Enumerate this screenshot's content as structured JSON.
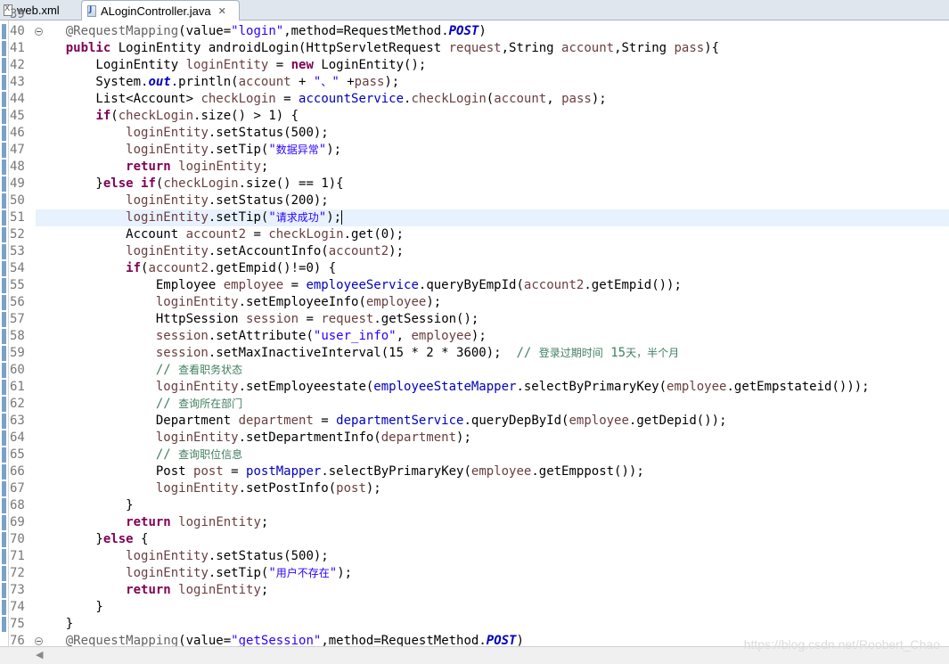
{
  "tabs": [
    {
      "label": "web.xml",
      "icon": "xml-file-icon"
    },
    {
      "label": "ALoginController.java",
      "icon": "java-file-icon",
      "close": "✕"
    }
  ],
  "colors": {
    "keyword": "#7f0055",
    "annotation": "#646464",
    "string": "#2a00ff",
    "comment": "#3f7f5f",
    "field": "#0000c0",
    "local_var": "#6a3e3e",
    "current_line": "#e8f2fe"
  },
  "code_lines": [
    {
      "n": "39",
      "text": ""
    },
    {
      "n": "40",
      "text": "    @RequestMapping(value=\"login\",method=RequestMethod.POST)",
      "fold": true
    },
    {
      "n": "41",
      "text": "    public LoginEntity androidLogin(HttpServletRequest request,String account,String pass){"
    },
    {
      "n": "42",
      "text": "        LoginEntity loginEntity = new LoginEntity();"
    },
    {
      "n": "43",
      "text": "        System.out.println(account + \"、\" +pass);"
    },
    {
      "n": "44",
      "text": "        List<Account> checkLogin = accountService.checkLogin(account, pass);"
    },
    {
      "n": "45",
      "text": "        if(checkLogin.size() > 1) {"
    },
    {
      "n": "46",
      "text": "            loginEntity.setStatus(500);"
    },
    {
      "n": "47",
      "text": "            loginEntity.setTip(\"数据异常\");"
    },
    {
      "n": "48",
      "text": "            return loginEntity;"
    },
    {
      "n": "49",
      "text": "        }else if(checkLogin.size() == 1){"
    },
    {
      "n": "50",
      "text": "            loginEntity.setStatus(200);"
    },
    {
      "n": "51",
      "text": "            loginEntity.setTip(\"请求成功\");",
      "current": true
    },
    {
      "n": "52",
      "text": "            Account account2 = checkLogin.get(0);"
    },
    {
      "n": "53",
      "text": "            loginEntity.setAccountInfo(account2);"
    },
    {
      "n": "54",
      "text": "            if(account2.getEmpid()!=0) {"
    },
    {
      "n": "55",
      "text": "                Employee employee = employeeService.queryByEmpId(account2.getEmpid());"
    },
    {
      "n": "56",
      "text": "                loginEntity.setEmployeeInfo(employee);"
    },
    {
      "n": "57",
      "text": "                HttpSession session = request.getSession();"
    },
    {
      "n": "58",
      "text": "                session.setAttribute(\"user_info\", employee);"
    },
    {
      "n": "59",
      "text": "                session.setMaxInactiveInterval(15 * 2 * 3600);  // 登录过期时间 15天，半个月"
    },
    {
      "n": "60",
      "text": "                // 查看职务状态"
    },
    {
      "n": "61",
      "text": "                loginEntity.setEmployeestate(employeeStateMapper.selectByPrimaryKey(employee.getEmpstateid()));"
    },
    {
      "n": "62",
      "text": "                // 查询所在部门"
    },
    {
      "n": "63",
      "text": "                Department department = departmentService.queryDepById(employee.getDepid());"
    },
    {
      "n": "64",
      "text": "                loginEntity.setDepartmentInfo(department);"
    },
    {
      "n": "65",
      "text": "                // 查询职位信息"
    },
    {
      "n": "66",
      "text": "                Post post = postMapper.selectByPrimaryKey(employee.getEmppost());"
    },
    {
      "n": "67",
      "text": "                loginEntity.setPostInfo(post);"
    },
    {
      "n": "68",
      "text": "            }"
    },
    {
      "n": "69",
      "text": "            return loginEntity;"
    },
    {
      "n": "70",
      "text": "        }else {"
    },
    {
      "n": "71",
      "text": "            loginEntity.setStatus(500);"
    },
    {
      "n": "72",
      "text": "            loginEntity.setTip(\"用户不存在\");"
    },
    {
      "n": "73",
      "text": "            return loginEntity;"
    },
    {
      "n": "74",
      "text": "        }"
    },
    {
      "n": "75",
      "text": "    }"
    },
    {
      "n": "76",
      "text": "    @RequestMapping(value=\"getSession\",method=RequestMethod.POST)",
      "fold": true
    }
  ],
  "watermark": "https://blog.csdn.net/Roobert_Chao"
}
